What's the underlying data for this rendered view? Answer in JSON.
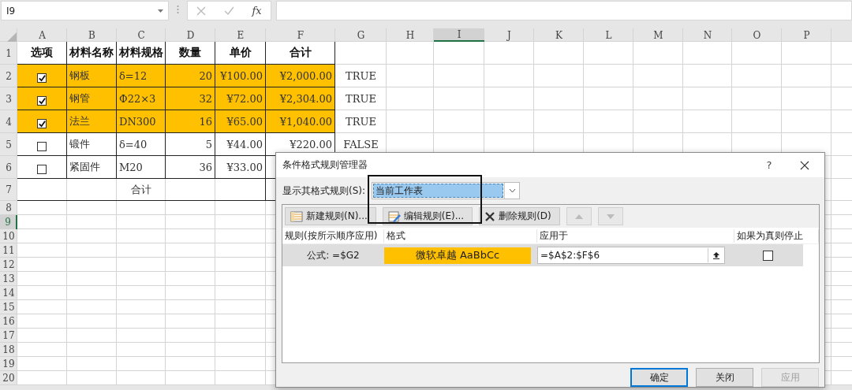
{
  "formula_bar": {
    "name_box": "I9",
    "function_label": "fx"
  },
  "sheet": {
    "columns": [
      {
        "label": "A",
        "selected": false
      },
      {
        "label": "B",
        "selected": false
      },
      {
        "label": "C",
        "selected": false
      },
      {
        "label": "D",
        "selected": false
      },
      {
        "label": "E",
        "selected": false
      },
      {
        "label": "F",
        "selected": false
      },
      {
        "label": "G",
        "selected": false
      },
      {
        "label": "H",
        "selected": false
      },
      {
        "label": "I",
        "selected": true
      },
      {
        "label": "J",
        "selected": false
      },
      {
        "label": "K",
        "selected": false
      },
      {
        "label": "L",
        "selected": false
      },
      {
        "label": "M",
        "selected": false
      },
      {
        "label": "N",
        "selected": false
      },
      {
        "label": "O",
        "selected": false
      },
      {
        "label": "P",
        "selected": false
      }
    ],
    "row_headers": [
      {
        "label": "1",
        "selected": false
      },
      {
        "label": "2",
        "selected": false
      },
      {
        "label": "3",
        "selected": false
      },
      {
        "label": "4",
        "selected": false
      },
      {
        "label": "5",
        "selected": false
      },
      {
        "label": "6",
        "selected": false
      },
      {
        "label": "7",
        "selected": false
      },
      {
        "label": "8",
        "selected": false
      },
      {
        "label": "9",
        "selected": true
      },
      {
        "label": "10",
        "selected": false
      },
      {
        "label": "11",
        "selected": false
      },
      {
        "label": "12",
        "selected": false
      },
      {
        "label": "13",
        "selected": false
      },
      {
        "label": "14",
        "selected": false
      },
      {
        "label": "15",
        "selected": false
      },
      {
        "label": "16",
        "selected": false
      },
      {
        "label": "17",
        "selected": false
      },
      {
        "label": "18",
        "selected": false
      },
      {
        "label": "19",
        "selected": false
      },
      {
        "label": "20",
        "selected": false
      }
    ],
    "table": {
      "header": [
        "选项",
        "材料名称",
        "材料规格",
        "数量",
        "单价",
        "合计"
      ],
      "rows": [
        {
          "checked": true,
          "highlighted": true,
          "name": "钢板",
          "spec": "δ=12",
          "qty": "20",
          "price": "¥100.00",
          "total": "¥2,000.00",
          "flag": "TRUE"
        },
        {
          "checked": true,
          "highlighted": true,
          "name": "钢管",
          "spec": "Φ22×3",
          "qty": "32",
          "price": "¥72.00",
          "total": "¥2,304.00",
          "flag": "TRUE"
        },
        {
          "checked": true,
          "highlighted": true,
          "name": "法兰",
          "spec": "DN300",
          "qty": "16",
          "price": "¥65.00",
          "total": "¥1,040.00",
          "flag": "TRUE"
        },
        {
          "checked": false,
          "highlighted": false,
          "name": "锻件",
          "spec": "δ=40",
          "qty": "5",
          "price": "¥44.00",
          "total": "¥220.00",
          "flag": "FALSE"
        },
        {
          "checked": false,
          "highlighted": false,
          "name": "紧固件",
          "spec": "M20",
          "qty": "36",
          "price": "¥33.00"
        }
      ],
      "total_row": {
        "label": "合计"
      }
    }
  },
  "dialog": {
    "title": "条件格式规则管理器",
    "help": "?",
    "scope_label": "显示其格式规则(S):",
    "scope_value": "当前工作表",
    "toolbar": [
      {
        "kind": "new",
        "label": "新建规则(N)..."
      },
      {
        "kind": "edit",
        "label": "编辑规则(E)..."
      },
      {
        "kind": "delete",
        "label": "删除规则(D)"
      }
    ],
    "move_buttons": [
      {
        "kind": "up",
        "disabled": true
      },
      {
        "kind": "down",
        "disabled": true
      }
    ],
    "columns": [
      "规则(按所示顺序应用)",
      "格式",
      "应用于",
      "如果为真则停止"
    ],
    "rules": [
      {
        "rule": "公式: =$G2",
        "preview": "微软卓越  AaBbCc",
        "applies_to": "=$A$2:$F$6",
        "stop_if_true": false,
        "selected": true
      }
    ],
    "buttons": [
      {
        "label": "确定",
        "default": true,
        "disabled": false
      },
      {
        "label": "关闭",
        "default": false,
        "disabled": false
      },
      {
        "label": "应用",
        "default": false,
        "disabled": true
      }
    ]
  }
}
